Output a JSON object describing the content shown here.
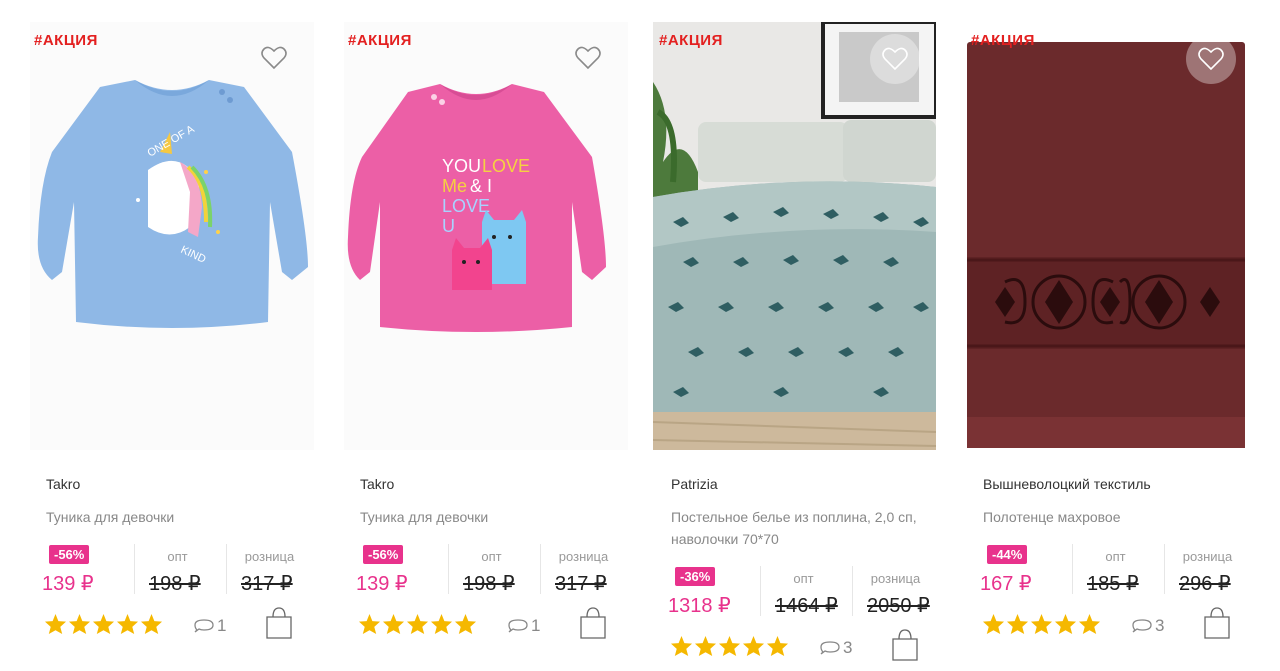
{
  "products": [
    {
      "promo": "#АКЦИЯ",
      "image": "blue-girls-tunic-unicorn",
      "brand": "Takro",
      "title": "Туника для девочки",
      "discount": "-56%",
      "sale_price": "139 ₽",
      "opt_label": "опт",
      "opt_price": "198 ₽",
      "retail_label": "розница",
      "retail_price": "317 ₽",
      "rating": 5,
      "comments": "1"
    },
    {
      "promo": "#АКЦИЯ",
      "image": "pink-girls-tunic-cats",
      "brand": "Takro",
      "title": "Туника для девочки",
      "discount": "-56%",
      "sale_price": "139 ₽",
      "opt_label": "опт",
      "opt_price": "198 ₽",
      "retail_label": "розница",
      "retail_price": "317 ₽",
      "rating": 5,
      "comments": "1"
    },
    {
      "promo": "#АКЦИЯ",
      "image": "bedding-set-dogs-print",
      "brand": "Patrizia",
      "title": "Постельное белье из поплина, 2,0 сп, наволочки 70*70",
      "discount": "-36%",
      "sale_price": "1318 ₽",
      "opt_label": "опт",
      "opt_price": "1464 ₽",
      "retail_label": "розница",
      "retail_price": "2050 ₽",
      "rating": 5,
      "comments": "3"
    },
    {
      "promo": "#АКЦИЯ",
      "image": "burgundy-terry-towel",
      "brand": "Вышневолоцкий текстиль",
      "title": "Полотенце махровое",
      "discount": "-44%",
      "sale_price": "167 ₽",
      "opt_label": "опт",
      "opt_price": "185 ₽",
      "retail_label": "розница",
      "retail_price": "296 ₽",
      "rating": 5,
      "comments": "3"
    }
  ],
  "colors": {
    "promo": "#e32020",
    "accent": "#e8328c",
    "star": "#f5b800",
    "muted": "#888888"
  },
  "icons": {
    "favorite": "heart-outline-icon",
    "comments": "speech-bubble-icon",
    "cart": "shopping-bag-icon",
    "rating": "star-icon"
  }
}
